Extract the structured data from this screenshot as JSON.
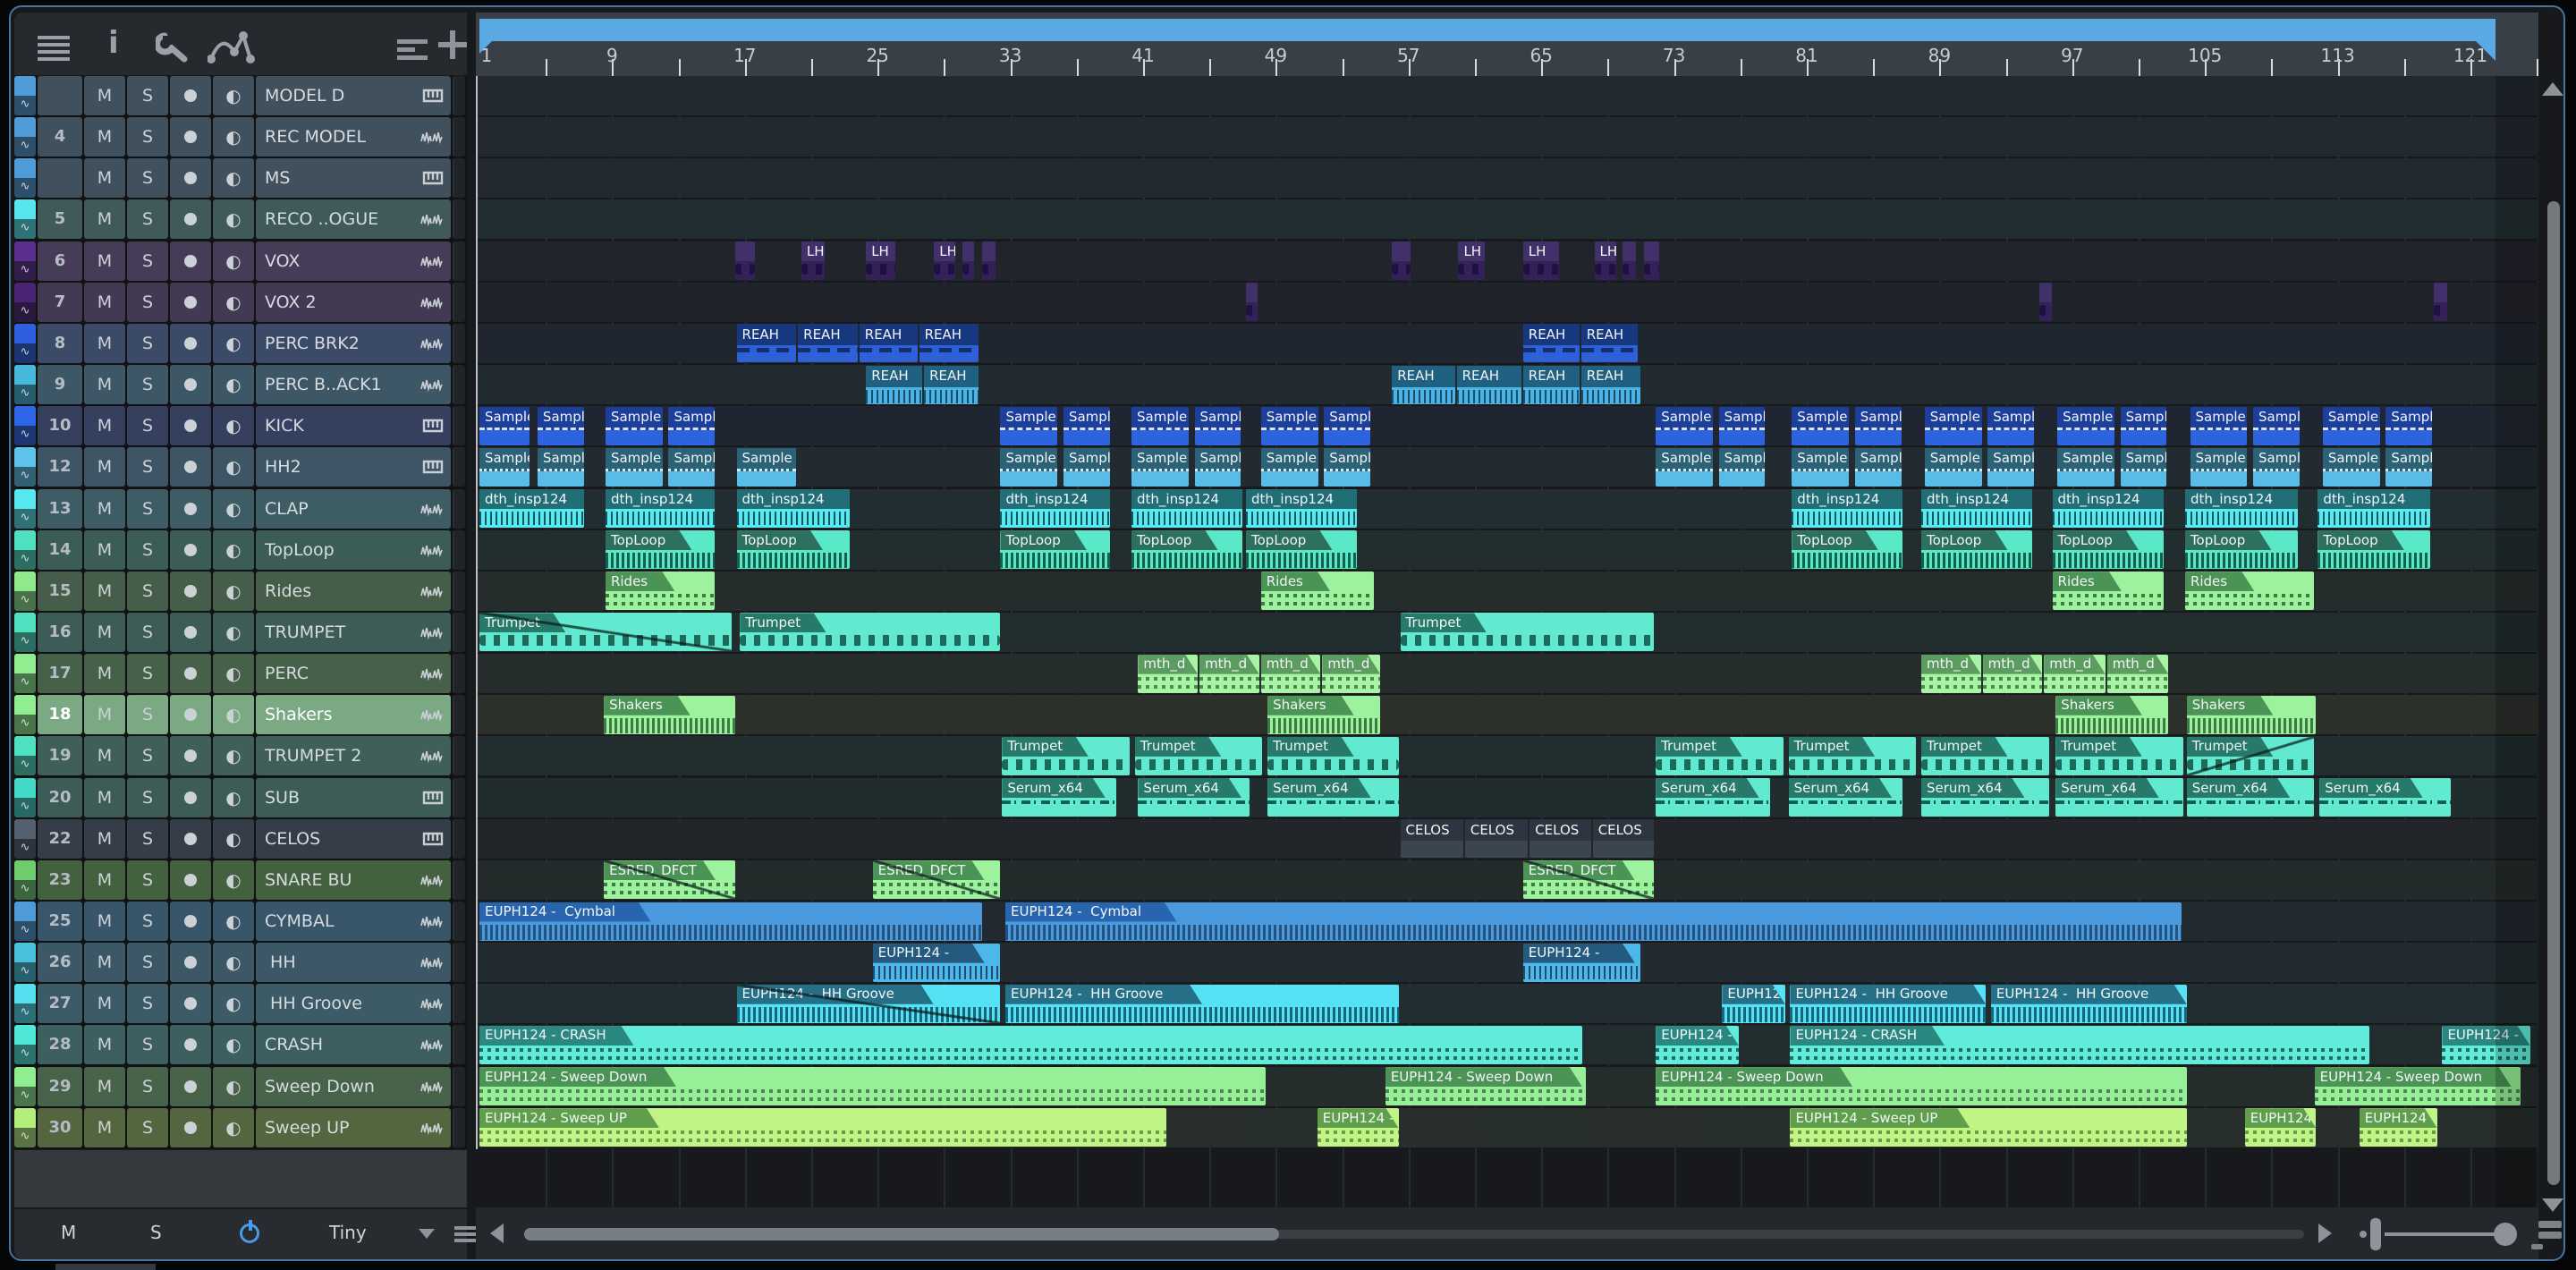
{
  "toolbar": {
    "info_label": "i",
    "icons": [
      "menu-icon",
      "info-icon",
      "wrench-icon",
      "automation-curve-icon",
      "track-list-options-icon",
      "add-track-icon"
    ]
  },
  "panel": {
    "footer": {
      "mute_label": "M",
      "solo_label": "S",
      "power_icon": "power-icon",
      "size_value": "Tiny"
    },
    "tracks": [
      {
        "num": "",
        "name": "MODEL D",
        "icon": "keys",
        "strip": "#4f9bd8",
        "tile": "#41505d"
      },
      {
        "num": "4",
        "name": "REC MODEL",
        "icon": "wave",
        "strip": "#4f9bd8",
        "tile": "#41505d"
      },
      {
        "num": "",
        "name": "MS",
        "icon": "keys",
        "strip": "#4f9bd8",
        "tile": "#41505d"
      },
      {
        "num": "5",
        "name": "RECO ..OGUE",
        "icon": "wave",
        "strip": "#55e6ee",
        "tile": "#3f5a59"
      },
      {
        "num": "6",
        "name": "VOX",
        "icon": "wave",
        "strip": "#5a2e8c",
        "tile": "#463c58",
        "cs": "vox",
        "cl": "LH"
      },
      {
        "num": "7",
        "name": "VOX 2",
        "icon": "wave",
        "strip": "#4b2373",
        "tile": "#423953",
        "cs": "vox",
        "cl": ""
      },
      {
        "num": "8",
        "name": "PERC BRK2",
        "icon": "wave",
        "strip": "#2d5fe0",
        "tile": "#3b4a67",
        "cs": "reahA",
        "cl": "REAH"
      },
      {
        "num": "9",
        "name": "PERC B..ACK1",
        "icon": "wave",
        "strip": "#45b8dc",
        "tile": "#3d5766",
        "cs": "reahB",
        "cl": "REAH"
      },
      {
        "num": "10",
        "name": "KICK",
        "icon": "keys",
        "strip": "#2f66e8",
        "tile": "#34405e",
        "cs": "kick",
        "cl": "Sample"
      },
      {
        "num": "12",
        "name": "HH2",
        "icon": "keys",
        "strip": "#5ec4ec",
        "tile": "#3d5565",
        "cs": "hh2",
        "cl": "Sample"
      },
      {
        "num": "13",
        "name": "CLAP",
        "icon": "wave",
        "strip": "#55e8ee",
        "tile": "#3d5c63",
        "cs": "clap",
        "cl": "dth_insp124"
      },
      {
        "num": "14",
        "name": "TopLoop",
        "icon": "wave",
        "strip": "#4fe0c0",
        "tile": "#3c5c56",
        "cs": "toploop",
        "cl": "TopLoop"
      },
      {
        "num": "15",
        "name": "Rides",
        "icon": "wave",
        "strip": "#8fe98a",
        "tile": "#455d49",
        "cs": "rides",
        "cl": "Rides"
      },
      {
        "num": "16",
        "name": "TRUMPET",
        "icon": "wave",
        "strip": "#4fe0c0",
        "tile": "#3d5c57",
        "cs": "trum",
        "cl": "Trumpet"
      },
      {
        "num": "17",
        "name": "PERC",
        "icon": "wave",
        "strip": "#90ee90",
        "tile": "#47604a",
        "cs": "mth",
        "cl": "mth_d"
      },
      {
        "num": "18",
        "name": "Shakers",
        "icon": "wave",
        "strip": "#90ee90",
        "tile": "#7aa983",
        "selected": true,
        "cs": "shak",
        "cl": "Shakers"
      },
      {
        "num": "19",
        "name": "TRUMPET 2",
        "icon": "wave",
        "strip": "#4fe0c0",
        "tile": "#405f58",
        "cs": "trum",
        "cl": "Trumpet"
      },
      {
        "num": "20",
        "name": "SUB",
        "icon": "keys",
        "strip": "#44d8c8",
        "tile": "#3d5b57",
        "cs": "serum",
        "cl": "Serum_x64"
      },
      {
        "num": "22",
        "name": "CELOS",
        "icon": "keys",
        "strip": "#55606e",
        "tile": "#353e48",
        "cs": "celos",
        "cl": "CELOS"
      },
      {
        "num": "23",
        "name": "SNARE BU",
        "icon": "wave",
        "strip": "#6ecb6e",
        "tile": "#43603f",
        "cs": "esred",
        "cl": "ESRED_DFCT"
      },
      {
        "num": "25",
        "name": "CYMBAL",
        "icon": "wave",
        "strip": "#4f9bd8",
        "tile": "#38556a",
        "cs": "cym",
        "cl": "EUPH124 -  Cymbal"
      },
      {
        "num": "26",
        "name": " HH",
        "icon": "wave",
        "strip": "#49c0dc",
        "tile": "#3c5866",
        "cs": "hhb",
        "cl": "EUPH124 - "
      },
      {
        "num": "27",
        "name": " HH Groove",
        "icon": "wave",
        "strip": "#55e0f0",
        "tile": "#3d5b67",
        "cs": "hhg",
        "cl": "EUPH124 -  HH Groove"
      },
      {
        "num": "28",
        "name": "CRASH",
        "icon": "wave",
        "strip": "#4fe8d8",
        "tile": "#3d5f5f",
        "cs": "crash",
        "cl": "EUPH124 - CRASH"
      },
      {
        "num": "29",
        "name": "Sweep Down",
        "icon": "wave",
        "strip": "#90ee90",
        "tile": "#49624a",
        "cs": "swd",
        "cl": "EUPH124 - Sweep Down"
      },
      {
        "num": "30",
        "name": "Sweep UP",
        "icon": "wave",
        "strip": "#b4ef7c",
        "tile": "#54663f",
        "cs": "swu",
        "cl": "EUPH124 - Sweep UP"
      }
    ]
  },
  "ruler": {
    "numbers": [
      1,
      9,
      17,
      25,
      33,
      41,
      49,
      57,
      65,
      73,
      81,
      89,
      97,
      105,
      113,
      121
    ],
    "tick_every_bars": 4,
    "number_every_bars": 8
  },
  "arrangement": {
    "clip_styles": {
      "vox": {
        "h": "#42306b",
        "b": "#352159",
        "hh": 22,
        "full": 1,
        "wk": "blob",
        "wc": "#1d1140"
      },
      "reahA": {
        "h": "#17377f",
        "b": "#2e61d8",
        "hh": 24,
        "full": 1,
        "wk": "dash",
        "wc": "#132f6e"
      },
      "reahB": {
        "h": "#206080",
        "b": "#4db2e4",
        "hh": 24,
        "full": 1,
        "wk": "ticks",
        "wc": "#175069"
      },
      "kick": {
        "h": "#1b3f9a",
        "b": "#2c64e0",
        "hh": 26,
        "full": 1,
        "hline": "dashed"
      },
      "hh2": {
        "h": "#2c6277",
        "b": "#59bce8",
        "hh": 26,
        "full": 1,
        "hline": "dotted"
      },
      "clap": {
        "h": "#226e76",
        "b": "#58eaf0",
        "hh": 22,
        "full": 1,
        "wk": "ticks",
        "wc": "#0f5a62"
      },
      "toploop": {
        "h": "#2e7060",
        "b": "#5ae9c8",
        "hh": 22,
        "wk": "dense",
        "wc": "#14604e"
      },
      "rides": {
        "h": "#4c9356",
        "b": "#9cf29d",
        "hh": 22,
        "wk": "dots",
        "wc": "#3f7a45"
      },
      "trum": {
        "h": "#27796a",
        "b": "#62ead0",
        "hh": 22,
        "wk": "blob",
        "wc": "#1c6a57"
      },
      "mth": {
        "h": "#5c9c60",
        "b": "#a6f4a4",
        "hh": 22,
        "wk": "dots",
        "wc": "#4c8a50"
      },
      "shak": {
        "h": "#4c9356",
        "b": "#9cf29d",
        "hh": 22,
        "wk": "dense",
        "wc": "#3f7a45"
      },
      "serum": {
        "h": "#27796a",
        "b": "#62ead0",
        "hh": 22,
        "wk": "dashdot",
        "wc": "#15604f"
      },
      "celos": {
        "h": "#2c3540",
        "b": "#3a4550",
        "hh": 24,
        "full": 1
      },
      "esred": {
        "h": "#4c9356",
        "b": "#9cf29d",
        "hh": 22,
        "wk": "dots",
        "wc": "#3f7a45"
      },
      "cym": {
        "h": "#2766ae",
        "b": "#4b9ade",
        "hh": 22,
        "wk": "dense",
        "wc": "#24537d"
      },
      "hhb": {
        "h": "#235a7e",
        "b": "#4db6ea",
        "hh": 22,
        "wk": "ticks",
        "wc": "#1d4d6b"
      },
      "hhg": {
        "h": "#257086",
        "b": "#55e2f4",
        "hh": 22,
        "wk": "dense",
        "wc": "#19657c"
      },
      "crash": {
        "h": "#2a8880",
        "b": "#60ebdb",
        "hh": 22,
        "wk": "dots",
        "wc": "#1e6e62"
      },
      "swd": {
        "h": "#4c9356",
        "b": "#96f096",
        "hh": 22,
        "wk": "dots",
        "wc": "#55855a"
      },
      "swu": {
        "h": "#5f9f4c",
        "b": "#c0f586",
        "hh": 22,
        "wk": "dots",
        "wc": "#6f9a4e"
      }
    },
    "clips": [
      [
        4,
        16.4,
        1.3,
        0,
        ""
      ],
      [
        4,
        20.4,
        1.5
      ],
      [
        4,
        24.3,
        1.9
      ],
      [
        4,
        28.4,
        1.4
      ],
      [
        4,
        30.1,
        0.8,
        0,
        ""
      ],
      [
        4,
        31.3,
        0.9,
        0,
        ""
      ],
      [
        4,
        56.0,
        1.2,
        0,
        ""
      ],
      [
        4,
        60.0,
        1.7
      ],
      [
        4,
        63.9,
        2.3
      ],
      [
        4,
        68.2,
        1.4
      ],
      [
        4,
        69.9,
        0.9,
        0,
        ""
      ],
      [
        4,
        71.2,
        1.0,
        0,
        ""
      ],
      [
        5,
        47.2,
        0.8
      ],
      [
        5,
        95.0,
        0.9
      ],
      [
        5,
        118.8,
        0.9
      ],
      [
        6,
        16.5,
        3.7
      ],
      [
        6,
        20.2,
        3.7
      ],
      [
        6,
        23.9,
        3.6
      ],
      [
        6,
        27.5,
        3.7
      ],
      [
        6,
        63.9,
        3.5
      ],
      [
        6,
        67.4,
        3.5
      ],
      [
        7,
        24.3,
        3.5
      ],
      [
        7,
        27.8,
        3.4
      ],
      [
        7,
        56.0,
        3.9
      ],
      [
        7,
        59.9,
        4.0
      ],
      [
        7,
        63.9,
        3.5
      ],
      [
        7,
        67.4,
        3.7
      ],
      [
        8,
        1,
        3.1
      ],
      [
        8,
        4.5,
        2.9
      ],
      [
        8,
        8.6,
        3.55
      ],
      [
        8,
        12.4,
        2.9
      ],
      [
        8,
        32.4,
        3.55
      ],
      [
        8,
        36.2,
        2.9
      ],
      [
        8,
        40.3,
        3.55
      ],
      [
        8,
        44.1,
        2.9
      ],
      [
        8,
        48.1,
        3.55
      ],
      [
        8,
        51.9,
        2.9
      ],
      [
        8,
        71.9,
        3.55
      ],
      [
        8,
        75.7,
        2.9
      ],
      [
        8,
        80.1,
        3.55
      ],
      [
        8,
        83.9,
        2.9
      ],
      [
        8,
        88.1,
        3.55
      ],
      [
        8,
        91.9,
        2.9
      ],
      [
        8,
        96.1,
        3.55
      ],
      [
        8,
        99.9,
        2.9
      ],
      [
        8,
        104.1,
        3.55
      ],
      [
        8,
        107.9,
        2.9
      ],
      [
        8,
        112.1,
        3.55
      ],
      [
        8,
        115.9,
        2.9
      ],
      [
        9,
        1,
        3.1
      ],
      [
        9,
        4.5,
        2.9
      ],
      [
        9,
        8.6,
        3.55
      ],
      [
        9,
        12.4,
        2.9
      ],
      [
        9,
        16.5,
        3.7
      ],
      [
        9,
        32.4,
        3.55
      ],
      [
        9,
        36.2,
        2.9
      ],
      [
        9,
        40.3,
        3.55
      ],
      [
        9,
        44.1,
        2.9
      ],
      [
        9,
        48.1,
        3.55
      ],
      [
        9,
        51.9,
        2.9
      ],
      [
        9,
        71.9,
        3.55
      ],
      [
        9,
        75.7,
        2.9
      ],
      [
        9,
        80.1,
        3.55
      ],
      [
        9,
        83.9,
        2.9
      ],
      [
        9,
        88.1,
        3.55
      ],
      [
        9,
        91.9,
        2.9
      ],
      [
        9,
        96.1,
        3.55
      ],
      [
        9,
        99.9,
        2.9
      ],
      [
        9,
        104.1,
        3.55
      ],
      [
        9,
        107.9,
        2.9
      ],
      [
        9,
        112.1,
        3.55
      ],
      [
        9,
        115.9,
        2.9
      ],
      [
        10,
        1,
        6.4
      ],
      [
        10,
        8.6,
        6.7
      ],
      [
        10,
        16.5,
        6.9
      ],
      [
        10,
        32.4,
        6.7
      ],
      [
        10,
        40.3,
        6.8
      ],
      [
        10,
        47.2,
        6.8
      ],
      [
        10,
        80.1,
        6.8
      ],
      [
        10,
        87.9,
        6.8
      ],
      [
        10,
        95.8,
        6.8
      ],
      [
        10,
        103.8,
        6.9
      ],
      [
        10,
        111.8,
        6.9
      ],
      [
        11,
        8.6,
        6.7
      ],
      [
        11,
        16.5,
        6.9
      ],
      [
        11,
        32.4,
        6.7
      ],
      [
        11,
        40.3,
        6.8
      ],
      [
        11,
        47.2,
        6.8
      ],
      [
        11,
        80.1,
        6.8
      ],
      [
        11,
        87.9,
        6.8
      ],
      [
        11,
        95.8,
        6.8
      ],
      [
        11,
        103.8,
        6.9
      ],
      [
        11,
        111.8,
        6.9
      ],
      [
        12,
        8.6,
        6.7
      ],
      [
        12,
        48.1,
        6.9
      ],
      [
        12,
        95.8,
        6.8
      ],
      [
        12,
        103.8,
        7.9
      ],
      [
        13,
        1,
        15.3,
        "i"
      ],
      [
        13,
        16.7,
        15.8
      ],
      [
        13,
        56.5,
        15.4
      ],
      [
        14,
        40.7,
        3.7
      ],
      [
        14,
        44.4,
        3.7
      ],
      [
        14,
        48.1,
        3.7
      ],
      [
        14,
        51.8,
        3.6
      ],
      [
        14,
        87.9,
        3.7
      ],
      [
        14,
        91.6,
        3.7
      ],
      [
        14,
        95.3,
        3.8
      ],
      [
        14,
        99.1,
        3.8
      ],
      [
        15,
        8.5,
        8.0
      ],
      [
        15,
        48.5,
        6.9
      ],
      [
        15,
        96.0,
        6.9
      ],
      [
        15,
        103.9,
        7.9
      ],
      [
        16,
        32.5,
        7.8
      ],
      [
        16,
        40.5,
        7.8
      ],
      [
        16,
        48.5,
        8.0
      ],
      [
        16,
        71.9,
        7.8
      ],
      [
        16,
        79.9,
        7.8
      ],
      [
        16,
        87.9,
        7.8
      ],
      [
        16,
        96.0,
        7.8
      ],
      [
        16,
        103.9,
        7.8,
        "o"
      ],
      [
        17,
        32.5,
        7.0
      ],
      [
        17,
        40.7,
        6.8
      ],
      [
        17,
        48.5,
        8.0
      ],
      [
        17,
        71.9,
        7.0
      ],
      [
        17,
        79.9,
        7.0
      ],
      [
        17,
        87.9,
        7.8
      ],
      [
        17,
        96.0,
        7.8
      ],
      [
        17,
        103.9,
        7.8
      ],
      [
        17,
        111.9,
        8.0
      ],
      [
        18,
        56.5,
        3.9
      ],
      [
        18,
        60.4,
        3.9
      ],
      [
        18,
        64.3,
        3.8
      ],
      [
        18,
        68.1,
        3.8
      ],
      [
        19,
        8.5,
        8.0,
        "i"
      ],
      [
        19,
        24.7,
        7.8,
        "i"
      ],
      [
        19,
        63.9,
        8.0,
        "i"
      ],
      [
        20,
        1,
        30.4
      ],
      [
        20,
        32.7,
        71.0
      ],
      [
        21,
        24.7,
        7.8
      ],
      [
        21,
        63.9,
        7.2
      ],
      [
        22,
        16.5,
        16.0,
        "i"
      ],
      [
        22,
        32.7,
        23.8
      ],
      [
        22,
        75.9,
        3.9
      ],
      [
        22,
        80.0,
        11.9
      ],
      [
        22,
        92.1,
        11.9
      ],
      [
        23,
        1,
        66.6
      ],
      [
        23,
        71.9,
        5.1
      ],
      [
        23,
        80.0,
        35.0
      ],
      [
        23,
        119.3,
        5.4
      ],
      [
        24,
        1,
        47.5
      ],
      [
        24,
        55.6,
        12.2
      ],
      [
        24,
        71.9,
        32.1
      ],
      [
        24,
        111.6,
        12.5
      ],
      [
        25,
        1,
        41.5
      ],
      [
        25,
        51.5,
        5.0
      ],
      [
        25,
        80.0,
        24.0
      ],
      [
        25,
        107.4,
        4.4
      ],
      [
        25,
        114.3,
        4.8
      ]
    ]
  }
}
